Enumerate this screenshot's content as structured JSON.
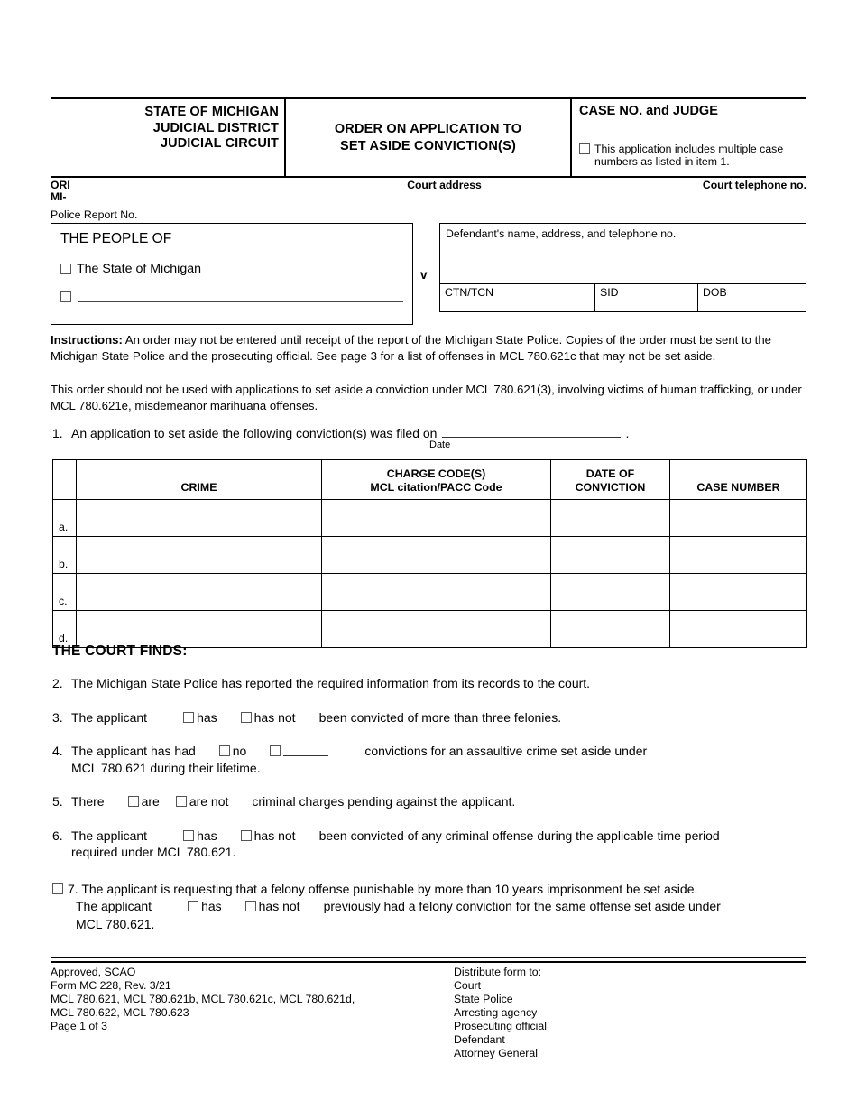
{
  "header": {
    "state_line1": "STATE OF MICHIGAN",
    "state_line2": "JUDICIAL DISTRICT",
    "state_line3": "JUDICIAL CIRCUIT",
    "form_title_line1": "ORDER ON APPLICATION TO",
    "form_title_line2": "SET ASIDE CONVICTION(S)",
    "case_no_label": "CASE NO. and JUDGE",
    "multiple_case_note_line1": "This application includes multiple case",
    "multiple_case_note_line2": "numbers as listed in item 1.",
    "ori_label": "ORI",
    "ori_prefix": "MI-",
    "court_address_label": "Court address",
    "court_telephone_label": "Court telephone no.",
    "police_report_label": "Police Report No."
  },
  "parties": {
    "people_of_label": "THE PEOPLE OF",
    "state_checkbox_label": "The State of Michigan",
    "other_checkbox_label": "",
    "versus": "v",
    "defendant_label": "Defendant's name, address, and telephone no.",
    "ctn_tcn_label": "CTN/TCN",
    "sid_label": "SID",
    "dob_label": "DOB"
  },
  "instructions": {
    "label": "Instructions:",
    "paragraph1": " An order may not be entered until receipt of the report of the Michigan State Police.  Copies of the order must be sent to the Michigan State Police and the prosecuting official. See page 3 for a list of offenses in MCL 780.621c that may not be set aside.",
    "paragraph2": "This order should not be used with applications to set aside a conviction under MCL 780.621(3), involving victims of human trafficking, or under MCL 780.621e, misdemeanor marihuana offenses."
  },
  "item1": {
    "number": "1.",
    "text_before": "An application to set aside the following conviction(s) was filed on",
    "text_after": ".",
    "date_caption": "Date"
  },
  "table": {
    "headers": {
      "index": "",
      "crime": "CRIME",
      "charge_code_line1": "CHARGE CODE(S)",
      "charge_code_line2": "MCL citation/PACC Code",
      "date_line1": "DATE OF",
      "date_line2": "CONVICTION",
      "case_number": "CASE NUMBER"
    },
    "rows": [
      {
        "index": "a.",
        "crime": "",
        "charge_code": "",
        "date_of_conviction": "",
        "case_number": ""
      },
      {
        "index": "b.",
        "crime": "",
        "charge_code": "",
        "date_of_conviction": "",
        "case_number": ""
      },
      {
        "index": "c.",
        "crime": "",
        "charge_code": "",
        "date_of_conviction": "",
        "case_number": ""
      },
      {
        "index": "d.",
        "crime": "",
        "charge_code": "",
        "date_of_conviction": "",
        "case_number": ""
      }
    ]
  },
  "court_finds": {
    "heading": "THE COURT FINDS:",
    "item2": {
      "number": "2.",
      "text": "The Michigan State Police has reported the required information from its records to the court."
    },
    "item3": {
      "number": "3.",
      "text_before": "The applicant",
      "option_has": "has",
      "option_has_not": "has not",
      "text_after": "been convicted of more than three felonies."
    },
    "item4": {
      "number": "4.",
      "text_before": "The applicant has had",
      "option_no": "no",
      "option_number": "",
      "text_after": "convictions for an assaultive crime set aside under",
      "text_line2": "MCL 780.621 during their lifetime."
    },
    "item5": {
      "number": "5.",
      "text_before": "There",
      "option_are": "are",
      "option_are_not": "are not",
      "text_after": "criminal charges pending against the applicant."
    },
    "item6": {
      "number": "6.",
      "text_before": "The applicant",
      "option_has": "has",
      "option_has_not": "has not",
      "text_after": "been convicted of any criminal offense during the applicable time period",
      "text_line2": "required under MCL 780.621."
    },
    "item7": {
      "number": "7.",
      "text_line1": "The applicant is requesting that a felony offense punishable by more than 10 years imprisonment be set aside.",
      "sub_before": "The applicant",
      "option_has": "has",
      "option_has_not": "has not",
      "sub_after": "previously had a felony conviction for the same offense set aside under",
      "text_line3": "MCL 780.621."
    }
  },
  "footer": {
    "left": [
      "Approved, SCAO",
      "Form MC 228, Rev. 3/21",
      "MCL 780.621, MCL 780.621b, MCL 780.621c, MCL 780.621d,",
      "MCL 780.622, MCL 780.623",
      "Page 1 of 3"
    ],
    "right": [
      "Distribute form to:",
      "Court",
      "State Police",
      "Arresting agency",
      "Prosecuting official",
      "Defendant",
      "Attorney General"
    ]
  }
}
